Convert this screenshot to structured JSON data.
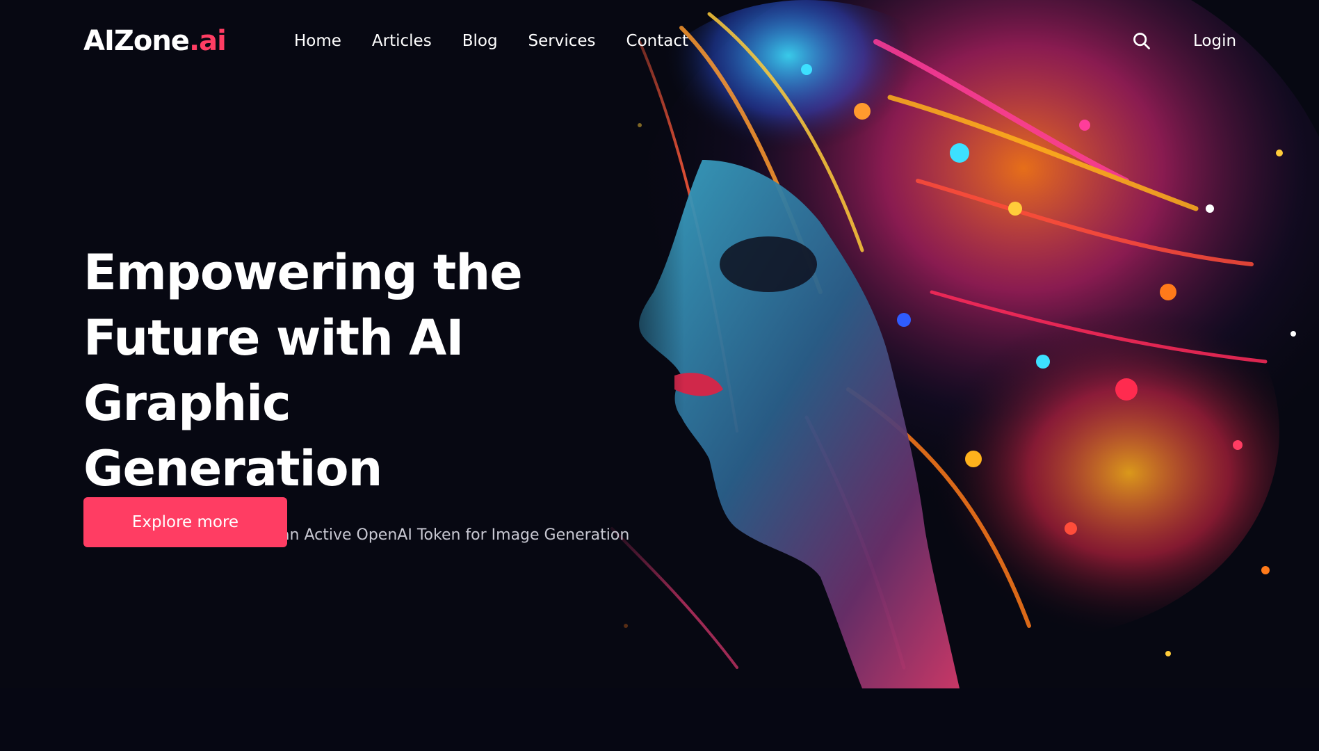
{
  "brand": {
    "name_main": "AIZone",
    "name_accent": ".ai",
    "accent_color": "#ff3d63"
  },
  "nav": {
    "items": [
      {
        "label": "Home"
      },
      {
        "label": "Articles"
      },
      {
        "label": "Blog"
      },
      {
        "label": "Services"
      },
      {
        "label": "Contact"
      }
    ],
    "search_icon": "search-icon",
    "login_label": "Login"
  },
  "hero": {
    "headline_line1": "Empowering the",
    "headline_line2": "Future with AI Graphic",
    "headline_line3": "Generation",
    "subtitle": "Unlock the potential with an Active OpenAI Token for Image Generation",
    "cta_label": "Explore more",
    "image_subject": "colorful-ai-face-portrait",
    "background_color": "#070812"
  }
}
